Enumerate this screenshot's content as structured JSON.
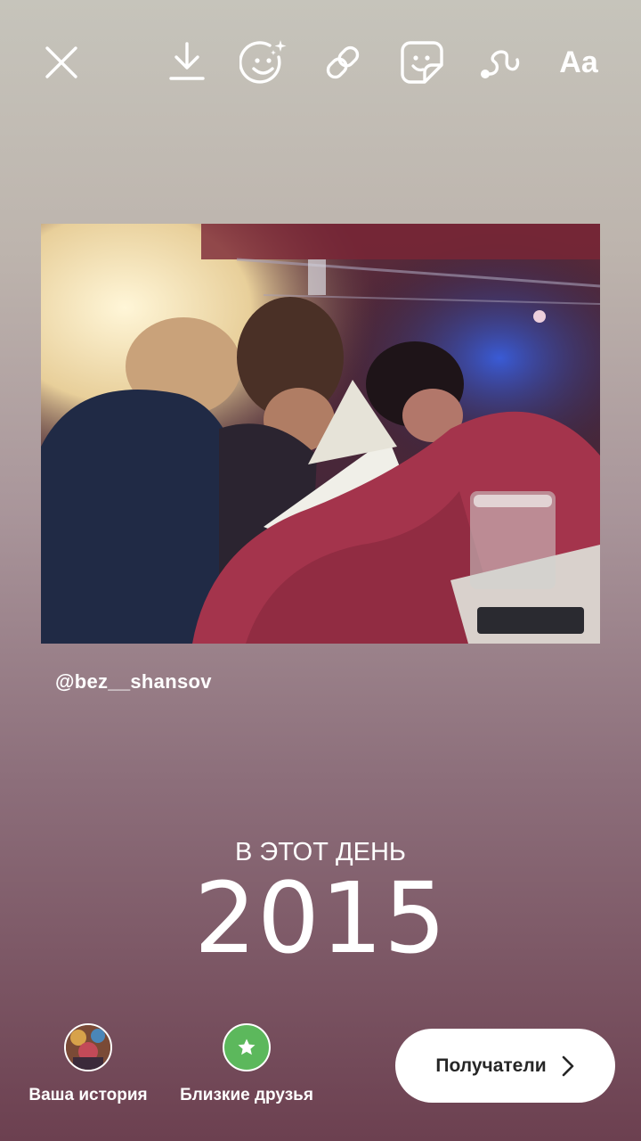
{
  "toolbar": {
    "close_icon": "close-icon",
    "download_icon": "download-icon",
    "face_effects_icon": "face-effects-icon",
    "link_icon": "link-icon",
    "sticker_icon": "sticker-icon",
    "draw_icon": "draw-icon",
    "text_tool_label": "Aa"
  },
  "photo": {
    "credit": "@bez__shansov"
  },
  "memory": {
    "label": "В ЭТОТ ДЕНЬ",
    "year": "2015"
  },
  "share": {
    "your_story_label": "Ваша история",
    "close_friends_label": "Близкие друзья",
    "recipients_label": "Получатели",
    "close_friends_color": "#5cb85c",
    "star_icon": "star-icon",
    "chevron_icon": "chevron-right-icon"
  }
}
